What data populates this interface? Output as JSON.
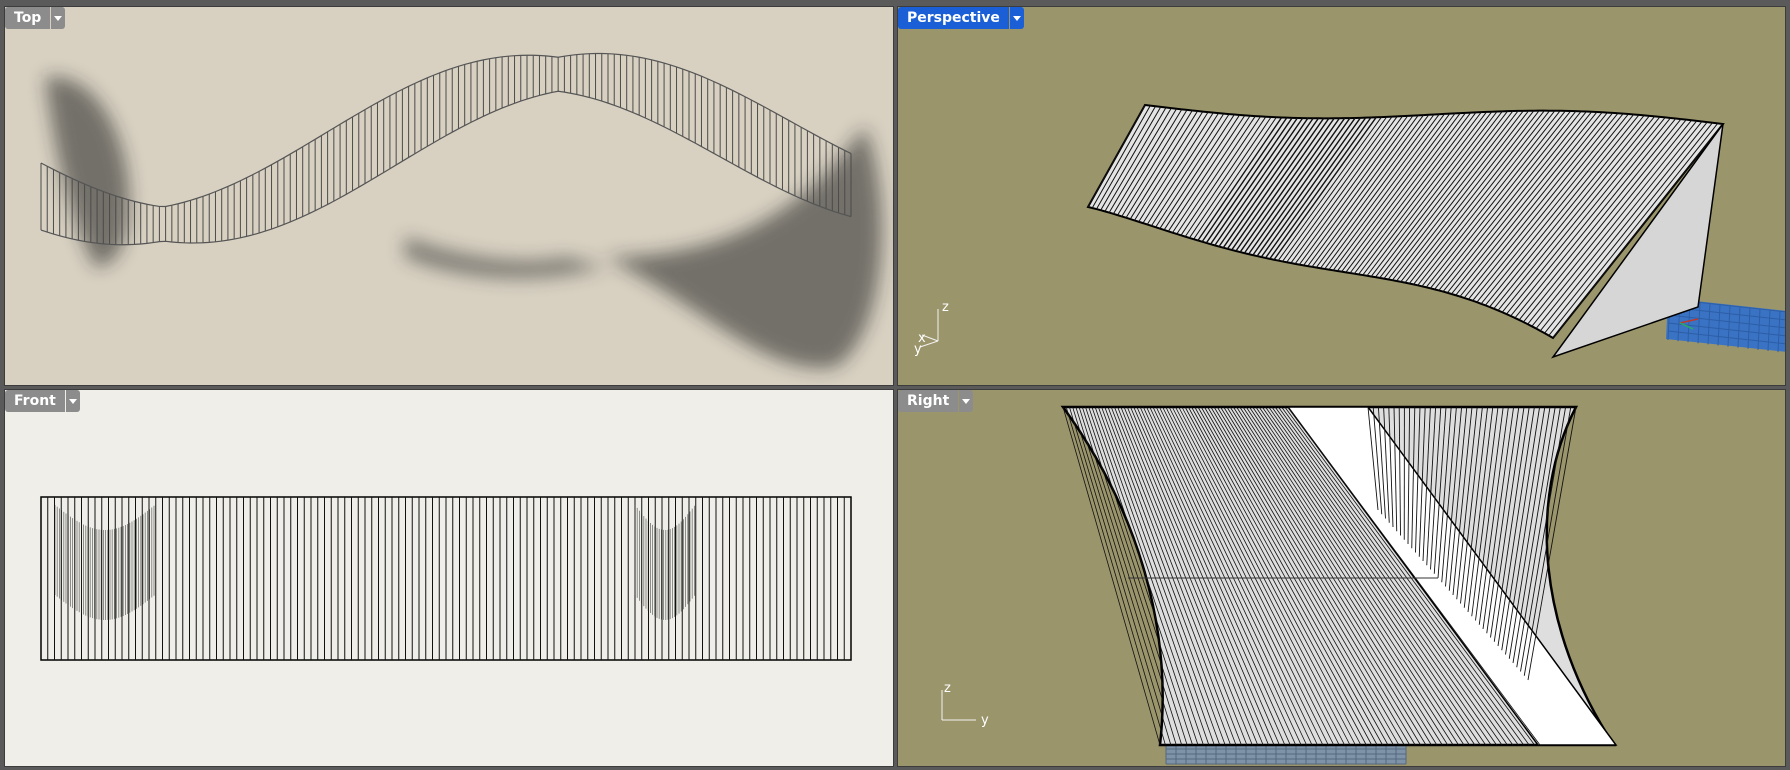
{
  "viewports": {
    "top": {
      "label": "Top"
    },
    "perspective": {
      "label": "Perspective"
    },
    "front": {
      "label": "Front"
    },
    "right": {
      "label": "Right"
    }
  },
  "axes": {
    "z": "z",
    "x": "x",
    "y": "y"
  },
  "colors": {
    "top_background": "#d8d1c2",
    "model_background": "#9b956c",
    "front_background": "#efeee8",
    "active_tab": "#1a5fd6",
    "inactive_tab": "#8c8c8c",
    "grid_plane": "#3a73c4"
  },
  "icons": {
    "dropdown": "chevron-down-icon"
  }
}
